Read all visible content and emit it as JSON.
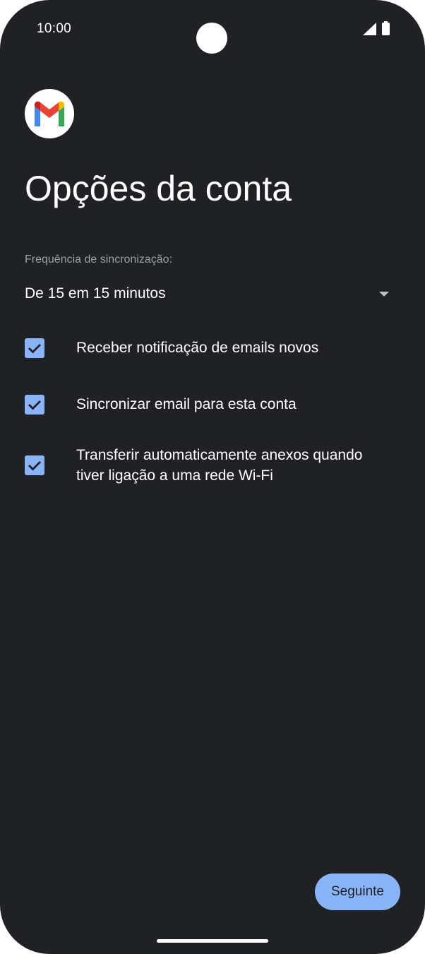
{
  "status_bar": {
    "time": "10:00",
    "icons": [
      "signal-icon",
      "battery-icon"
    ]
  },
  "app": {
    "logo_icon": "gmail-icon",
    "title": "Opções da conta"
  },
  "sync": {
    "label": "Frequência de sincronização:",
    "selected_value": "De 15 em 15 minutos"
  },
  "options": [
    {
      "label": "Receber notificação de emails novos",
      "checked": true
    },
    {
      "label": "Sincronizar email para esta conta",
      "checked": true
    },
    {
      "label": "Transferir automaticamente anexos quando tiver ligação a uma rede Wi-Fi",
      "checked": true
    }
  ],
  "actions": {
    "next_label": "Seguinte"
  },
  "colors": {
    "background": "#202124",
    "accent": "#8ab4f8",
    "text_primary": "#ffffff",
    "text_secondary": "#9aa0a6"
  }
}
